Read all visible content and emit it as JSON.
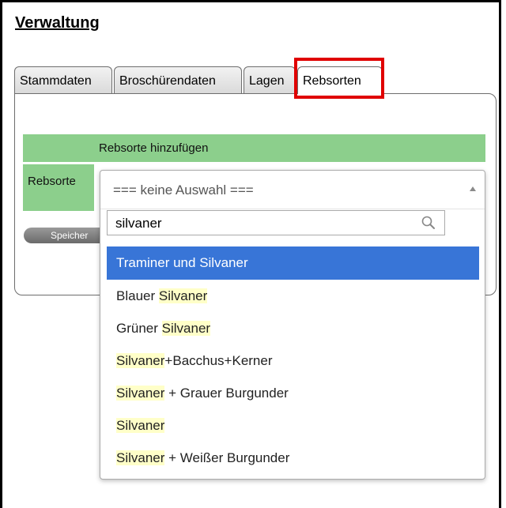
{
  "page": {
    "title": "Verwaltung"
  },
  "tabs": [
    {
      "label": "Stammdaten",
      "active": false
    },
    {
      "label": "Broschürendaten",
      "active": false
    },
    {
      "label": "Lagen",
      "active": false
    },
    {
      "label": "Rebsorten",
      "active": true
    }
  ],
  "form": {
    "section_header": "Rebsorte hinzufügen",
    "field_label": "Rebsorte",
    "save_button": "Speicher"
  },
  "select": {
    "current_value": "=== keine Auswahl ===",
    "search_value": "silvaner",
    "options": [
      {
        "before": "Traminer und Silvaner",
        "match": "",
        "after": "",
        "selected": true
      },
      {
        "before": "Blauer ",
        "match": "Silvaner",
        "after": "",
        "selected": false
      },
      {
        "before": "Grüner ",
        "match": "Silvaner",
        "after": "",
        "selected": false
      },
      {
        "before": "",
        "match": "Silvaner",
        "after": "+Bacchus+Kerner",
        "selected": false
      },
      {
        "before": "",
        "match": "Silvaner",
        "after": " + Grauer Burgunder",
        "selected": false
      },
      {
        "before": "",
        "match": "Silvaner",
        "after": "",
        "selected": false
      },
      {
        "before": "",
        "match": "Silvaner",
        "after": " + Weißer Burgunder",
        "selected": false
      }
    ]
  },
  "colors": {
    "header_green": "#8ccf8c",
    "selected_option": "#3875d7",
    "match_highlight": "#ffffc8",
    "callout_red": "#e00000"
  }
}
